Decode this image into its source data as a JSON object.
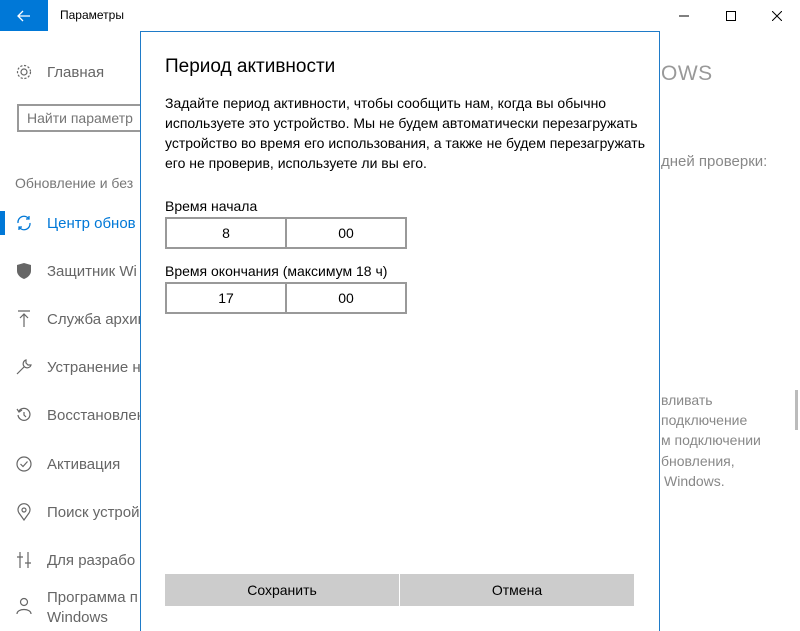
{
  "window": {
    "title": "Параметры"
  },
  "sidebar": {
    "home_label": "Главная",
    "search_placeholder": "Найти параметр",
    "section_title": "Обновление и без",
    "items": [
      {
        "label": "Центр обнов",
        "icon": "sync-icon"
      },
      {
        "label": "Защитник Wi",
        "icon": "shield-icon"
      },
      {
        "label": "Служба архив",
        "icon": "backup-arrow-icon"
      },
      {
        "label": "Устранение н",
        "icon": "wrench-icon"
      },
      {
        "label": "Восстановлен",
        "icon": "restore-icon"
      },
      {
        "label": "Активация",
        "icon": "check-circle-icon"
      },
      {
        "label": "Поиск устрой",
        "icon": "find-device-icon"
      },
      {
        "label": "Для разрабо",
        "icon": "developer-icon"
      },
      {
        "label": "Программа п",
        "label2": "Windows",
        "icon": "insider-icon"
      }
    ]
  },
  "background": {
    "heading_fragment": "OWS",
    "line1": "дней проверки:",
    "p1": "вливать",
    "p2": "подключение",
    "p3": "м подключении",
    "p4": "бновления,",
    "p5": "Windows."
  },
  "dialog": {
    "title": "Период активности",
    "description": "Задайте период активности, чтобы сообщить нам, когда вы обычно используете это устройство. Мы не будем автоматически перезагружать устройство во время его использования, а также не будем перезагружать его не проверив, используете ли вы его.",
    "start": {
      "label": "Время начала",
      "hour": "8",
      "minute": "00"
    },
    "end": {
      "label": "Время окончания (максимум 18 ч)",
      "hour": "17",
      "minute": "00"
    },
    "save_label": "Сохранить",
    "cancel_label": "Отмена"
  },
  "colors": {
    "accent": "#0078d7",
    "dialog_border": "#1f7bc8",
    "button_bg": "#cccccc"
  }
}
